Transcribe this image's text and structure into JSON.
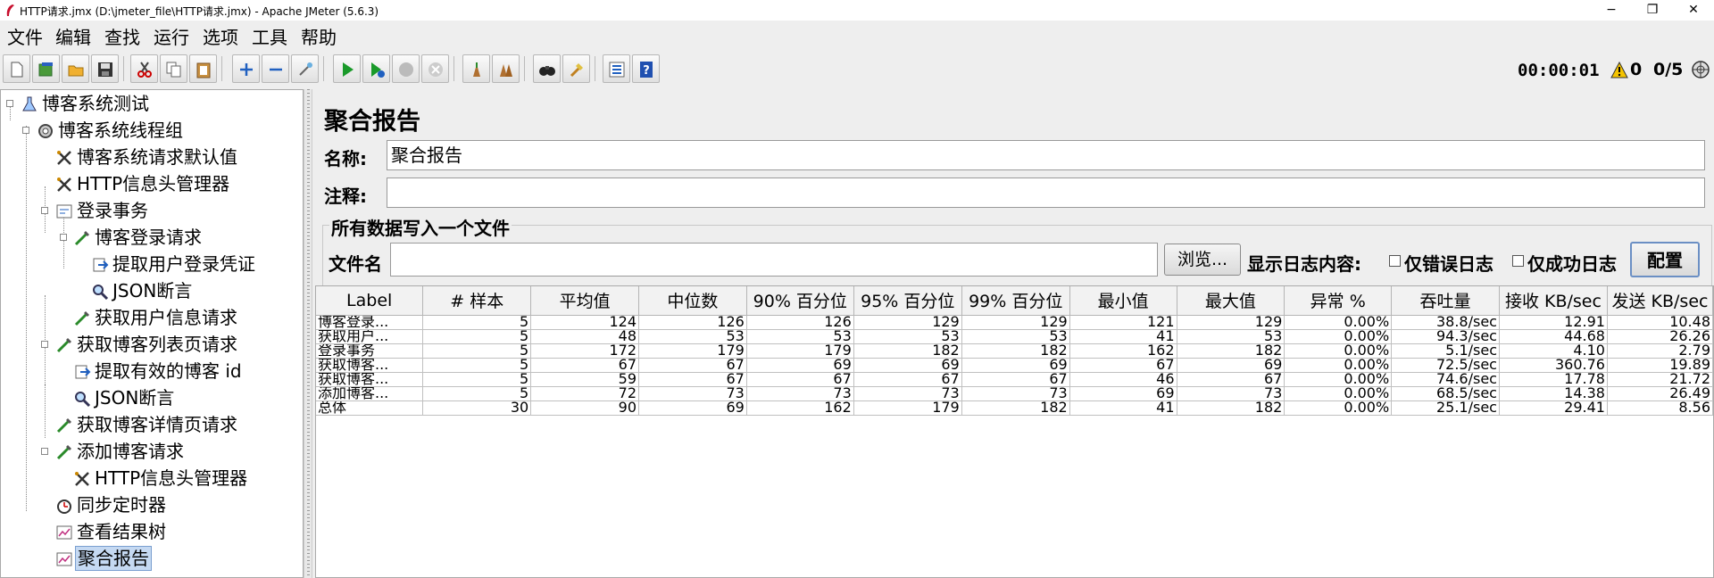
{
  "window": {
    "title": "HTTP请求.jmx (D:\\jmeter_file\\HTTP请求.jmx) - Apache JMeter (5.6.3)",
    "minimize": "−",
    "maximize": "❐",
    "close": "✕"
  },
  "menu": [
    "文件",
    "编辑",
    "查找",
    "运行",
    "选项",
    "工具",
    "帮助"
  ],
  "toolbar": {
    "icons": [
      "new-icon",
      "templates-icon",
      "open-icon",
      "save-icon",
      "cut-icon",
      "copy-icon",
      "paste-icon",
      "expand-icon",
      "collapse-icon",
      "toggle-icon",
      "start-icon",
      "start-no-pause-icon",
      "stop-icon",
      "shutdown-icon",
      "clear-icon",
      "clear-all-icon",
      "search-icon",
      "reset-search-icon",
      "function-helper-icon",
      "help-icon"
    ]
  },
  "status": {
    "timer": "00:00:01",
    "warnings": "0",
    "threads": "0/5"
  },
  "tree": [
    {
      "label": "博客系统测试",
      "icon": "test-plan-icon",
      "level": 0
    },
    {
      "label": "博客系统线程组",
      "icon": "thread-group-icon",
      "level": 1
    },
    {
      "label": "博客系统请求默认值",
      "icon": "config-icon",
      "level": 2
    },
    {
      "label": "HTTP信息头管理器",
      "icon": "config-icon",
      "level": 2
    },
    {
      "label": "登录事务",
      "icon": "transaction-icon",
      "level": 2
    },
    {
      "label": "博客登录请求",
      "icon": "sampler-icon",
      "level": 3
    },
    {
      "label": "提取用户登录凭证",
      "icon": "extractor-icon",
      "level": 4
    },
    {
      "label": "JSON断言",
      "icon": "assertion-icon",
      "level": 4
    },
    {
      "label": "获取用户信息请求",
      "icon": "sampler-icon",
      "level": 3
    },
    {
      "label": "获取博客列表页请求",
      "icon": "sampler-icon",
      "level": 2
    },
    {
      "label": "提取有效的博客 id",
      "icon": "extractor-icon",
      "level": 3
    },
    {
      "label": "JSON断言",
      "icon": "assertion-icon",
      "level": 3
    },
    {
      "label": "获取博客详情页请求",
      "icon": "sampler-icon",
      "level": 2
    },
    {
      "label": "添加博客请求",
      "icon": "sampler-icon",
      "level": 2
    },
    {
      "label": "HTTP信息头管理器",
      "icon": "config-icon",
      "level": 3
    },
    {
      "label": "同步定时器",
      "icon": "timer-icon",
      "level": 2
    },
    {
      "label": "查看结果树",
      "icon": "listener-icon",
      "level": 2
    },
    {
      "label": "聚合报告",
      "icon": "listener-icon",
      "level": 2,
      "selected": true
    }
  ],
  "panel": {
    "title": "聚合报告",
    "name_label": "名称:",
    "name_value": "聚合报告",
    "comment_label": "注释:",
    "comment_value": "",
    "group_title": "所有数据写入一个文件",
    "filename_label": "文件名",
    "filename_value": "",
    "browse_button": "浏览...",
    "log_label": "显示日志内容:",
    "errors_only": "仅错误日志",
    "success_only": "仅成功日志",
    "configure_button": "配置"
  },
  "table": {
    "headers": [
      "Label",
      "# 样本",
      "平均值",
      "中位数",
      "90% 百分位",
      "95% 百分位",
      "99% 百分位",
      "最小值",
      "最大值",
      "异常 %",
      "吞吐量",
      "接收 KB/sec",
      "发送 KB/sec"
    ],
    "rows": [
      [
        "博客登录...",
        "5",
        "124",
        "126",
        "126",
        "129",
        "129",
        "121",
        "129",
        "0.00%",
        "38.8/sec",
        "12.91",
        "10.48"
      ],
      [
        "获取用户...",
        "5",
        "48",
        "53",
        "53",
        "53",
        "53",
        "41",
        "53",
        "0.00%",
        "94.3/sec",
        "44.68",
        "26.26"
      ],
      [
        "登录事务",
        "5",
        "172",
        "179",
        "179",
        "182",
        "182",
        "162",
        "182",
        "0.00%",
        "5.1/sec",
        "4.10",
        "2.79"
      ],
      [
        "获取博客...",
        "5",
        "67",
        "67",
        "69",
        "69",
        "69",
        "67",
        "69",
        "0.00%",
        "72.5/sec",
        "360.76",
        "19.89"
      ],
      [
        "获取博客...",
        "5",
        "59",
        "67",
        "67",
        "67",
        "67",
        "46",
        "67",
        "0.00%",
        "74.6/sec",
        "17.78",
        "21.72"
      ],
      [
        "添加博客...",
        "5",
        "72",
        "73",
        "73",
        "73",
        "73",
        "69",
        "73",
        "0.00%",
        "68.5/sec",
        "14.38",
        "26.49"
      ],
      [
        "总体",
        "30",
        "90",
        "69",
        "162",
        "179",
        "182",
        "41",
        "182",
        "0.00%",
        "25.1/sec",
        "29.41",
        "8.56"
      ]
    ]
  }
}
